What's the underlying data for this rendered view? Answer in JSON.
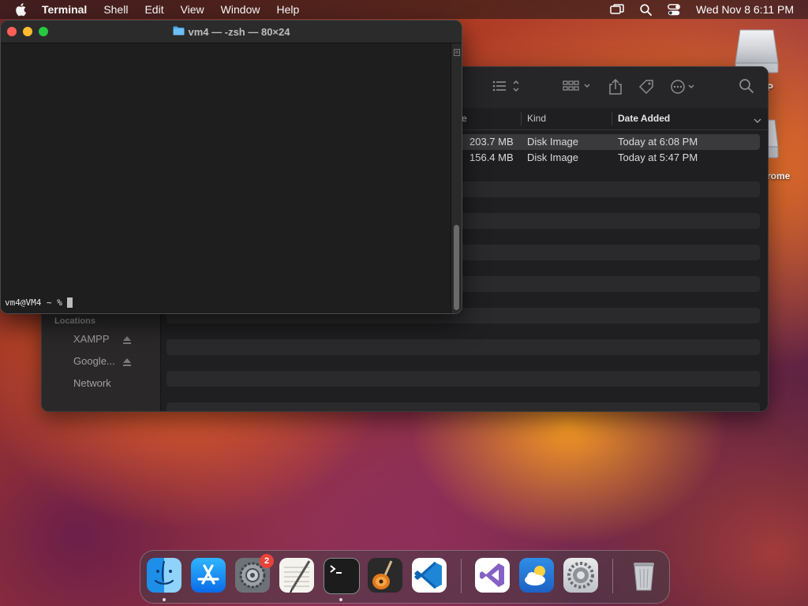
{
  "menubar": {
    "app_name": "Terminal",
    "menus": [
      "Shell",
      "Edit",
      "View",
      "Window",
      "Help"
    ],
    "clock": "Wed Nov 8  6:11 PM"
  },
  "desktop": {
    "icons": [
      {
        "label": "P",
        "icon": "drive-icon"
      },
      {
        "label": "rome",
        "icon": "drive-icon"
      }
    ]
  },
  "finder": {
    "sidebar": {
      "section": "Locations",
      "items": [
        {
          "label": "XAMPP",
          "ejectable": true
        },
        {
          "label": "Google...",
          "ejectable": true
        },
        {
          "label": "Network",
          "ejectable": false
        }
      ]
    },
    "columns": [
      "e",
      "Kind",
      "Date Added"
    ],
    "files": [
      {
        "size": "203.7 MB",
        "kind": "Disk Image",
        "date_added": "Today at 6:08 PM"
      },
      {
        "size": "156.4 MB",
        "kind": "Disk Image",
        "date_added": "Today at 5:47 PM"
      }
    ]
  },
  "terminal": {
    "title": "vm4 — -zsh — 80×24",
    "prompt": "vm4@VM4 ~ %"
  },
  "dock": {
    "apps": [
      {
        "name": "Finder",
        "running": true
      },
      {
        "name": "App Store",
        "running": false
      },
      {
        "name": "System Preferences",
        "running": false,
        "badge": "2"
      },
      {
        "name": "TextEdit",
        "running": false
      },
      {
        "name": "Terminal",
        "running": true
      },
      {
        "name": "GarageBand",
        "running": false
      },
      {
        "name": "Visual Studio Code",
        "running": false
      },
      {
        "name": "Visual Studio",
        "running": false
      },
      {
        "name": "Weather",
        "running": false
      },
      {
        "name": "Settings",
        "running": false
      },
      {
        "name": "Trash",
        "running": false
      }
    ]
  },
  "colors": {
    "close": "#ff5f57",
    "minimize": "#febc2e",
    "zoom": "#28c840",
    "badge": "#e8433a"
  }
}
